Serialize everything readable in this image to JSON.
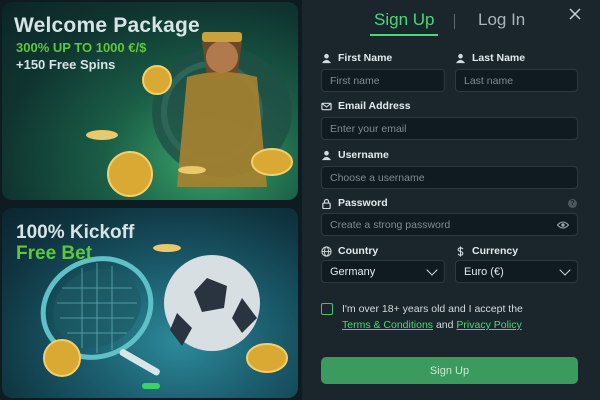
{
  "promo": {
    "welcome_title": "Welcome Package",
    "welcome_bonus": "300% UP TO 1000 €/$",
    "welcome_spins": "+150 Free Spins",
    "kickoff_title": "100% Kickoff",
    "kickoff_sub": "Free Bet"
  },
  "tabs": {
    "signup": "Sign Up",
    "login": "Log In"
  },
  "form": {
    "first_name_label": "First Name",
    "first_name_placeholder": "First name",
    "last_name_label": "Last Name",
    "last_name_placeholder": "Last name",
    "email_label": "Email Address",
    "email_placeholder": "Enter your email",
    "username_label": "Username",
    "username_placeholder": "Choose a username",
    "password_label": "Password",
    "password_placeholder": "Create a strong password",
    "country_label": "Country",
    "country_value": "Germany",
    "currency_label": "Currency",
    "currency_value": "Euro (€)",
    "terms_line1": "I'm over 18+ years old and I accept the",
    "terms_link1": "Terms & Conditions",
    "terms_and": "and",
    "terms_link2": "Privacy Policy",
    "submit_label": "Sign Up",
    "help_glyph": "?"
  },
  "icons": {
    "close": "close-icon",
    "user": "user-icon",
    "mail": "mail-icon",
    "lock": "lock-icon",
    "globe": "globe-icon",
    "dollar": "dollar-icon",
    "eye": "eye-icon",
    "chevron": "chevron-down-icon"
  },
  "colors": {
    "accent": "#4ed67a",
    "panel": "#1a262c",
    "button": "#3b9a5d"
  }
}
